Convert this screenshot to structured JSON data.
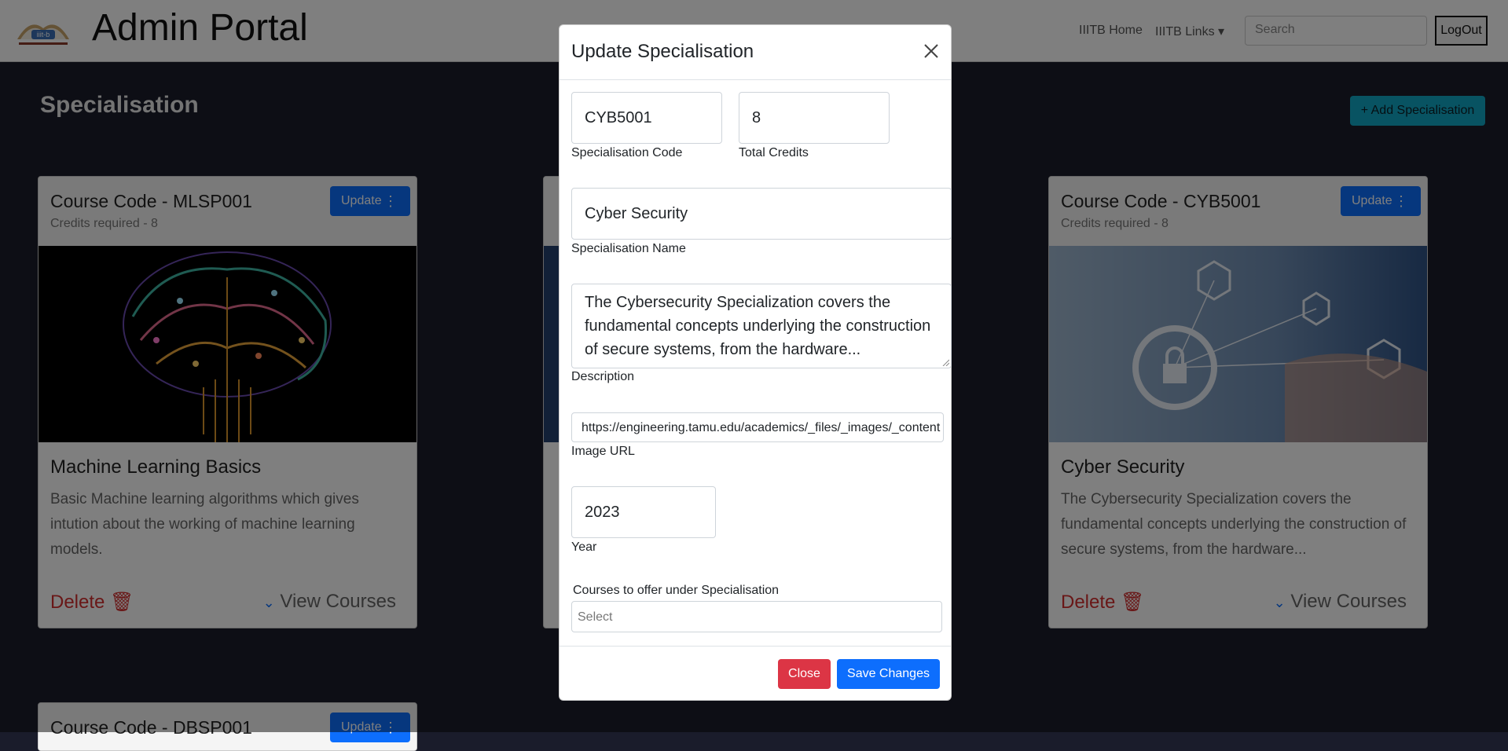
{
  "navbar": {
    "brand": "Admin Portal",
    "home_link": "IIITB Home",
    "links_menu": "IIITB Links ▾",
    "search_placeholder": "Search",
    "logout_label": "LogOut"
  },
  "page": {
    "section_title": "Specialisation",
    "add_button": "+ Add Specialisation"
  },
  "cards": [
    {
      "code": "Course Code - MLSP001",
      "credits": "Credits required - 8",
      "update_label": "Update",
      "title": "Machine Learning Basics",
      "description": "Basic Machine learning algorithms which gives intution about the working of machine learning models.",
      "delete_label": "Delete",
      "view_label": "View Courses"
    },
    {
      "code": "Course Code - CYB5001",
      "credits": "Credits required - 8",
      "update_label": "Update",
      "title": "Cyber Security",
      "description": "The Cybersecurity Specialization covers the fundamental concepts underlying the construction of secure systems, from the hardware...",
      "delete_label": "Delete",
      "view_label": "View Courses"
    },
    {
      "code": "Course Code - DBSP001",
      "update_label": "Update"
    }
  ],
  "modal": {
    "title": "Update Specialisation",
    "code_value": "CYB5001",
    "code_label": "Specialisation Code",
    "credits_value": "8",
    "credits_label": "Total Credits",
    "name_value": "Cyber Security",
    "name_label": "Specialisation Name",
    "description_value": "The Cybersecurity Specialization covers the fundamental concepts underlying the construction of secure systems, from the hardware...",
    "description_label": "Description",
    "url_value": "https://engineering.tamu.edu/academics/_files/_images/_content",
    "url_label": "Image URL",
    "year_value": "2023",
    "year_label": "Year",
    "courses_label": "Courses to offer under Specialisation",
    "courses_placeholder": "Select",
    "close_label": "Close",
    "save_label": "Save Changes"
  },
  "colors": {
    "primary": "#0d6efd",
    "danger": "#dc3545",
    "info": "#11a6c4"
  }
}
